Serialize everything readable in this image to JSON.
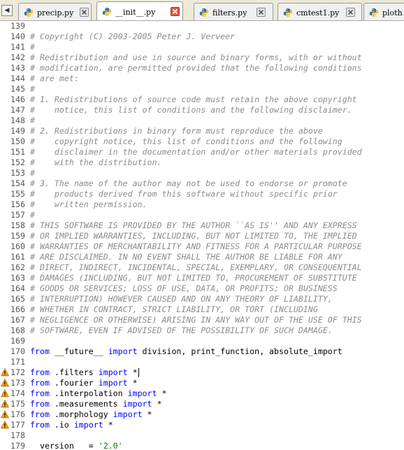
{
  "tabs": [
    {
      "label": "precip.py",
      "active": false,
      "close_icon": "close-icon"
    },
    {
      "label": "__init__.py",
      "active": true,
      "close_icon": "close-icon"
    },
    {
      "label": "filters.py",
      "active": false,
      "close_icon": "close-icon"
    },
    {
      "label": "cmtest1.py",
      "active": false,
      "close_icon": "close-icon"
    },
    {
      "label": "ploth",
      "active": false,
      "close_icon": "close-icon"
    }
  ],
  "editor": {
    "lines": [
      {
        "n": "139",
        "kind": "blank",
        "text": ""
      },
      {
        "n": "140",
        "kind": "comment",
        "text": "# Copyright (C) 2003-2005 Peter J. Verveer"
      },
      {
        "n": "141",
        "kind": "comment",
        "text": "#"
      },
      {
        "n": "142",
        "kind": "comment",
        "text": "# Redistribution and use in source and binary forms, with or without"
      },
      {
        "n": "143",
        "kind": "comment",
        "text": "# modification, are permitted provided that the following conditions"
      },
      {
        "n": "144",
        "kind": "comment",
        "text": "# are met:"
      },
      {
        "n": "145",
        "kind": "comment",
        "text": "#"
      },
      {
        "n": "146",
        "kind": "comment",
        "text": "# 1. Redistributions of source code must retain the above copyright"
      },
      {
        "n": "147",
        "kind": "comment",
        "text": "#    notice, this list of conditions and the following disclaimer."
      },
      {
        "n": "148",
        "kind": "comment",
        "text": "#"
      },
      {
        "n": "149",
        "kind": "comment",
        "text": "# 2. Redistributions in binary form must reproduce the above"
      },
      {
        "n": "150",
        "kind": "comment",
        "text": "#    copyright notice, this list of conditions and the following"
      },
      {
        "n": "151",
        "kind": "comment",
        "text": "#    disclaimer in the documentation and/or other materials provided"
      },
      {
        "n": "152",
        "kind": "comment",
        "text": "#    with the distribution."
      },
      {
        "n": "153",
        "kind": "comment",
        "text": "#"
      },
      {
        "n": "154",
        "kind": "comment",
        "text": "# 3. The name of the author may not be used to endorse or promote"
      },
      {
        "n": "155",
        "kind": "comment",
        "text": "#    products derived from this software without specific prior"
      },
      {
        "n": "156",
        "kind": "comment",
        "text": "#    written permission."
      },
      {
        "n": "157",
        "kind": "comment",
        "text": "#"
      },
      {
        "n": "158",
        "kind": "comment",
        "text": "# THIS SOFTWARE IS PROVIDED BY THE AUTHOR ``AS IS'' AND ANY EXPRESS"
      },
      {
        "n": "159",
        "kind": "comment",
        "text": "# OR IMPLIED WARRANTIES, INCLUDING, BUT NOT LIMITED TO, THE IMPLIED"
      },
      {
        "n": "160",
        "kind": "comment",
        "text": "# WARRANTIES OF MERCHANTABILITY AND FITNESS FOR A PARTICULAR PURPOSE"
      },
      {
        "n": "161",
        "kind": "comment",
        "text": "# ARE DISCLAIMED. IN NO EVENT SHALL THE AUTHOR BE LIABLE FOR ANY"
      },
      {
        "n": "162",
        "kind": "comment",
        "text": "# DIRECT, INDIRECT, INCIDENTAL, SPECIAL, EXEMPLARY, OR CONSEQUENTIAL"
      },
      {
        "n": "163",
        "kind": "comment",
        "text": "# DAMAGES (INCLUDING, BUT NOT LIMITED TO, PROCUREMENT OF SUBSTITUTE"
      },
      {
        "n": "164",
        "kind": "comment",
        "text": "# GOODS OR SERVICES; LOSS OF USE, DATA, OR PROFITS; OR BUSINESS"
      },
      {
        "n": "165",
        "kind": "comment",
        "text": "# INTERRUPTION) HOWEVER CAUSED AND ON ANY THEORY OF LIABILITY,"
      },
      {
        "n": "166",
        "kind": "comment",
        "text": "# WHETHER IN CONTRACT, STRICT LIABILITY, OR TORT (INCLUDING"
      },
      {
        "n": "167",
        "kind": "comment",
        "text": "# NEGLIGENCE OR OTHERWISE) ARISING IN ANY WAY OUT OF THE USE OF THIS"
      },
      {
        "n": "168",
        "kind": "comment",
        "text": "# SOFTWARE, EVEN IF ADVISED OF THE POSSIBILITY OF SUCH DAMAGE."
      },
      {
        "n": "169",
        "kind": "blank",
        "text": ""
      },
      {
        "n": "170",
        "kind": "import",
        "kw1": "from",
        "mod": " __future__ ",
        "kw2": "import",
        "rest": " division, print_function, absolute_import"
      },
      {
        "n": "171",
        "kind": "blank",
        "text": ""
      },
      {
        "n": "172",
        "kind": "import",
        "warn": true,
        "caret": true,
        "kw1": "from",
        "mod": " .filters ",
        "kw2": "import",
        "rest": " *"
      },
      {
        "n": "173",
        "kind": "import",
        "warn": true,
        "kw1": "from",
        "mod": " .fourier ",
        "kw2": "import",
        "rest": " *"
      },
      {
        "n": "174",
        "kind": "import",
        "warn": true,
        "kw1": "from",
        "mod": " .interpolation ",
        "kw2": "import",
        "rest": " *"
      },
      {
        "n": "175",
        "kind": "import",
        "warn": true,
        "kw1": "from",
        "mod": " .measurements ",
        "kw2": "import",
        "rest": " *"
      },
      {
        "n": "176",
        "kind": "import",
        "warn": true,
        "kw1": "from",
        "mod": " .morphology ",
        "kw2": "import",
        "rest": " *"
      },
      {
        "n": "177",
        "kind": "import",
        "warn": true,
        "kw1": "from",
        "mod": " .io ",
        "kw2": "import",
        "rest": " *"
      },
      {
        "n": "178",
        "kind": "blank",
        "text": ""
      },
      {
        "n": "179",
        "kind": "assign",
        "name": "__version__",
        "op": " = ",
        "str": "'2.0'"
      }
    ]
  }
}
